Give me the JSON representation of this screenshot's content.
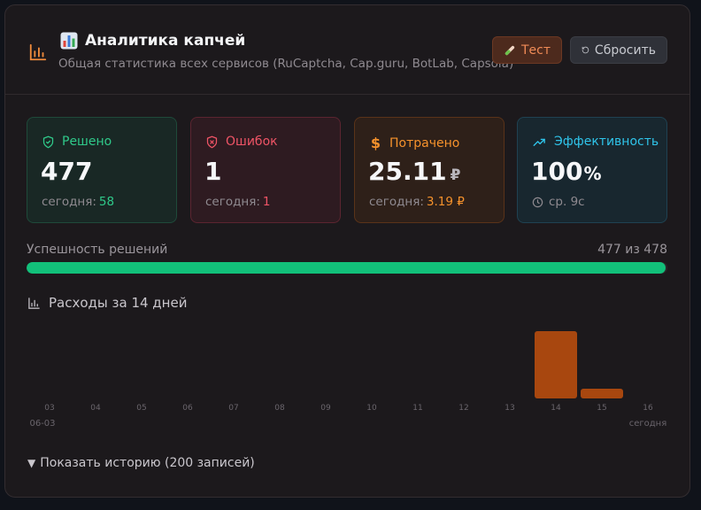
{
  "header": {
    "title": "Аналитика капчей",
    "subtitle": "Общая статистика всех сервисов (RuCaptcha, Cap.guru, BotLab, Capsola)",
    "icon": "bar-chart-icon",
    "title_emoji": "bar-chart-emoji-icon",
    "test_label": "Тест",
    "reset_label": "Сбросить"
  },
  "stats": {
    "solved": {
      "label": "Решено",
      "value": "477",
      "today_prefix": "сегодня:",
      "today": "58",
      "icon": "shield-check-icon",
      "color": "#2fc98a"
    },
    "errors": {
      "label": "Ошибок",
      "value": "1",
      "today_prefix": "сегодня:",
      "today": "1",
      "icon": "shield-x-icon",
      "color": "#ef5466"
    },
    "spent": {
      "label": "Потрачено",
      "value": "25.11",
      "unit": "₽",
      "today_prefix": "сегодня:",
      "today": "3.19 ₽",
      "icon": "dollar-icon",
      "color": "#f6922c"
    },
    "efficiency": {
      "label": "Эффективность",
      "value": "100",
      "unit": "%",
      "avg": "ср. 9с",
      "icon": "trending-up-icon",
      "color": "#2fc4ea"
    }
  },
  "progress": {
    "label": "Успешность решений",
    "count": "477 из 478",
    "ratio": 0.9979,
    "color": "#12c07a"
  },
  "chart_data": {
    "type": "bar",
    "title": "Расходы за 14 дней",
    "categories": [
      "03",
      "04",
      "05",
      "06",
      "07",
      "08",
      "09",
      "10",
      "11",
      "12",
      "13",
      "14",
      "15",
      "16"
    ],
    "values": [
      0,
      0,
      0,
      0,
      0,
      0,
      0,
      0,
      0,
      0,
      0,
      21.92,
      3.19,
      0
    ],
    "sub_labels": {
      "first": "06-03",
      "last": "сегодня"
    },
    "bar_color": "#a8470f"
  },
  "history": {
    "label": "Показать историю (200 записей)",
    "icon": "triangle-down-icon"
  }
}
